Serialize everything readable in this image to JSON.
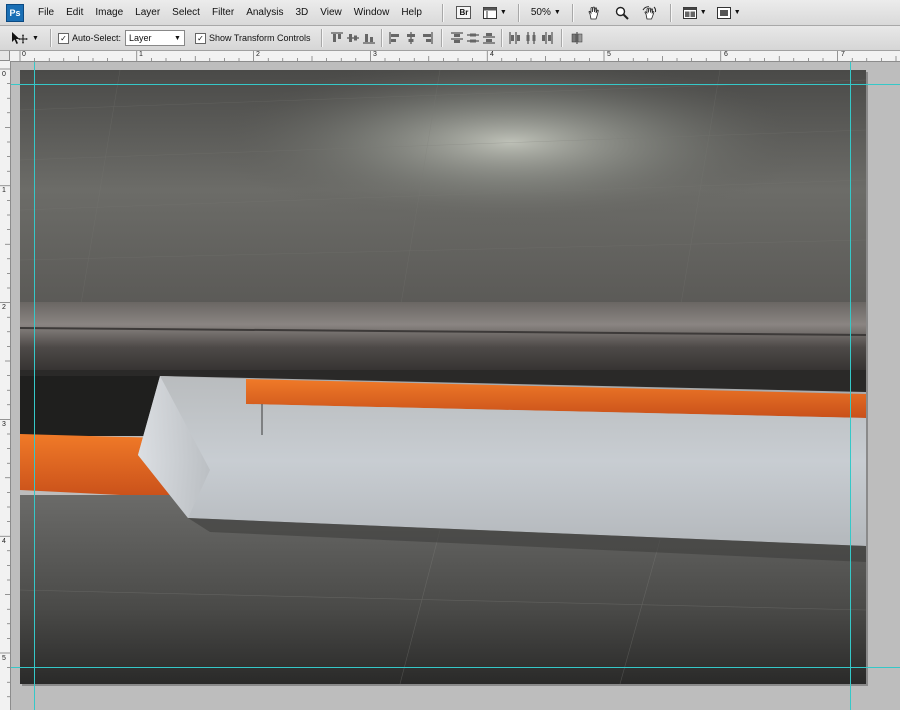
{
  "app": {
    "logo_text": "Ps"
  },
  "menu": {
    "items": [
      "File",
      "Edit",
      "Image",
      "Layer",
      "Select",
      "Filter",
      "Analysis",
      "3D",
      "View",
      "Window",
      "Help"
    ]
  },
  "appbar": {
    "bridge_label": "Br",
    "zoom": "50%"
  },
  "options": {
    "auto_select_label": "Auto-Select:",
    "auto_select_checked": true,
    "auto_select_value": "Layer",
    "show_transform_label": "Show Transform Controls",
    "show_transform_checked": true
  },
  "rulers": {
    "top_labels": [
      "0",
      "1",
      "2",
      "3",
      "4",
      "5",
      "6",
      "7"
    ],
    "left_labels": [
      "0",
      "1",
      "2",
      "3",
      "4",
      "5"
    ]
  },
  "colors": {
    "guide": "#35c8c8",
    "orange_stripe": "#e0571c",
    "menu_highlight": "#c8d8ef"
  }
}
